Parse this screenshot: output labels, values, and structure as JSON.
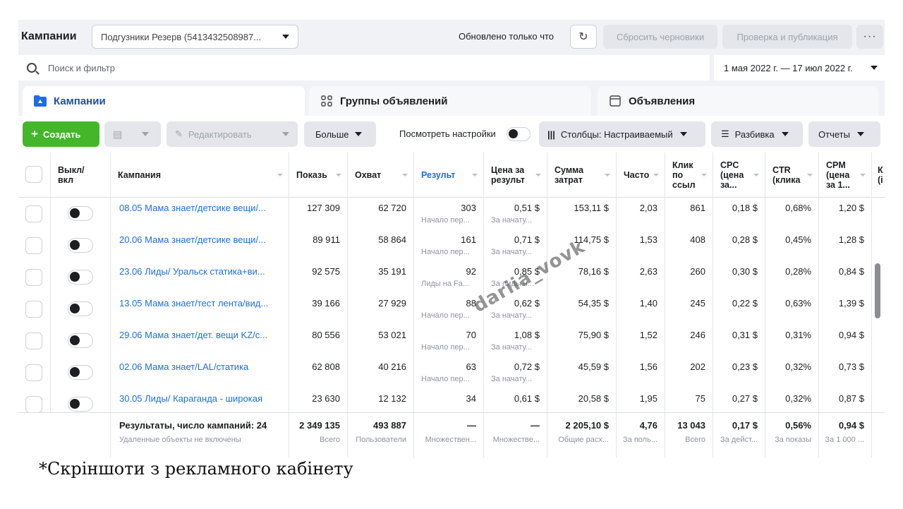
{
  "topbar": {
    "title": "Кампании",
    "account": "Подгузники Резерв (5413432508987...",
    "updated_text": "Обновлено только что",
    "reset_drafts": "Сбросить черновики",
    "review_publish": "Проверка и публикация",
    "more": "···"
  },
  "search": {
    "placeholder": "Поиск и фильтр",
    "date_range": "1 мая 2022 г. — 17 июл 2022 г."
  },
  "tabs": [
    {
      "label": "Кампании"
    },
    {
      "label": "Группы объявлений"
    },
    {
      "label": "Объявления"
    }
  ],
  "toolbar": {
    "create": "Создать",
    "edit": "Редактировать",
    "more": "Больше",
    "view_settings": "Посмотреть настройки",
    "columns": "Столбцы: Настраиваемый",
    "breakdown": "Разбивка",
    "reports": "Отчеты"
  },
  "columns": {
    "onoff": "Выкл/\nвкл",
    "campaign": "Кампания",
    "impressions": "Показь",
    "reach": "Охват",
    "results": "Результ",
    "cost_per_result": "Цена за\nрезульт",
    "amount_spent": "Сумма\nзатрат",
    "frequency": "Часто",
    "link_clicks": "Клик\nпо\nссыл",
    "cpc": "CPC\n(цена\nза...",
    "ctr": "CTR\n(клика",
    "cpm": "CPM\n(цена\nза 1...",
    "extra": "К\n(і"
  },
  "rows": [
    {
      "name": "08.05 Мама знает/детсике вещи/...",
      "impressions": "127 309",
      "reach": "62 720",
      "results": "303",
      "results_sub": "Начало пер...",
      "cpr": "0,51 $",
      "cpr_sub": "За начату...",
      "spent": "153,11 $",
      "freq": "2,03",
      "clicks": "861",
      "cpc": "0,18 $",
      "ctr": "0,68%",
      "cpm": "1,20 $"
    },
    {
      "name": "20.06 Мама знает/детсике вещи/...",
      "impressions": "89 911",
      "reach": "58 864",
      "results": "161",
      "results_sub": "Начало пер...",
      "cpr": "0,71 $",
      "cpr_sub": "За начату...",
      "spent": "114,75 $",
      "freq": "1,53",
      "clicks": "408",
      "cpc": "0,28 $",
      "ctr": "0,45%",
      "cpm": "1,28 $"
    },
    {
      "name": "23.06 Лиды/ Уральск статика+ви...",
      "impressions": "92 575",
      "reach": "35 191",
      "results": "92",
      "results_sub": "Лиды на Fa...",
      "cpr": "0,85 $",
      "cpr_sub": "За лиды н...",
      "spent": "78,16 $",
      "freq": "2,63",
      "clicks": "260",
      "cpc": "0,30 $",
      "ctr": "0,28%",
      "cpm": "0,84 $"
    },
    {
      "name": "13.05 Мама знает/тест лента/вид...",
      "impressions": "39 166",
      "reach": "27 929",
      "results": "88",
      "results_sub": "Начало пер...",
      "cpr": "0,62 $",
      "cpr_sub": "За начату...",
      "spent": "54,35 $",
      "freq": "1,40",
      "clicks": "245",
      "cpc": "0,22 $",
      "ctr": "0,63%",
      "cpm": "1,39 $"
    },
    {
      "name": "29.06 Мама знает/дет. вещи KZ/с...",
      "impressions": "80 556",
      "reach": "53 021",
      "results": "70",
      "results_sub": "Начало пер...",
      "cpr": "1,08 $",
      "cpr_sub": "За начату...",
      "spent": "75,90 $",
      "freq": "1,52",
      "clicks": "246",
      "cpc": "0,31 $",
      "ctr": "0,31%",
      "cpm": "0,94 $"
    },
    {
      "name": "02.06 Мама знает/LAL/статика",
      "impressions": "62 808",
      "reach": "40 216",
      "results": "63",
      "results_sub": "Начало пер...",
      "cpr": "0,72 $",
      "cpr_sub": "За начату...",
      "spent": "45,59 $",
      "freq": "1,56",
      "clicks": "202",
      "cpc": "0,23 $",
      "ctr": "0,32%",
      "cpm": "0,73 $"
    },
    {
      "name": "30.05 Лиды/ Караганда - широкая",
      "impressions": "23 630",
      "reach": "12 132",
      "results": "34",
      "results_sub": "",
      "cpr": "0,61 $",
      "cpr_sub": "",
      "spent": "20,58 $",
      "freq": "1,95",
      "clicks": "75",
      "cpc": "0,27 $",
      "ctr": "0,32%",
      "cpm": "0,87 $"
    }
  ],
  "totals": {
    "label": "Результаты, число кампаний: 24",
    "label_sub": "Удаленные объекты не включены",
    "impressions": "2 349 135",
    "impressions_sub": "Всего",
    "reach": "493 887",
    "reach_sub": "Пользователи",
    "results": "—",
    "results_sub": "Множествен...",
    "cpr": "—",
    "cpr_sub": "Множестве...",
    "spent": "2 205,10 $",
    "spent_sub": "Общие расх...",
    "freq": "4,76",
    "freq_sub": "За поль...",
    "clicks": "13 043",
    "clicks_sub": "Всего",
    "cpc": "0,17 $",
    "cpc_sub": "За дейст...",
    "ctr": "0,56%",
    "ctr_sub": "За показы",
    "cpm": "0,94 $",
    "cpm_sub": "За 1 000 ..."
  },
  "watermark": "dariia_vovk",
  "caption": "*Скріншоти з рекламного кабінету",
  "colors": {
    "accent": "#1d6fe0",
    "create": "#42b72a",
    "tab_active": "#1d4fa8"
  }
}
